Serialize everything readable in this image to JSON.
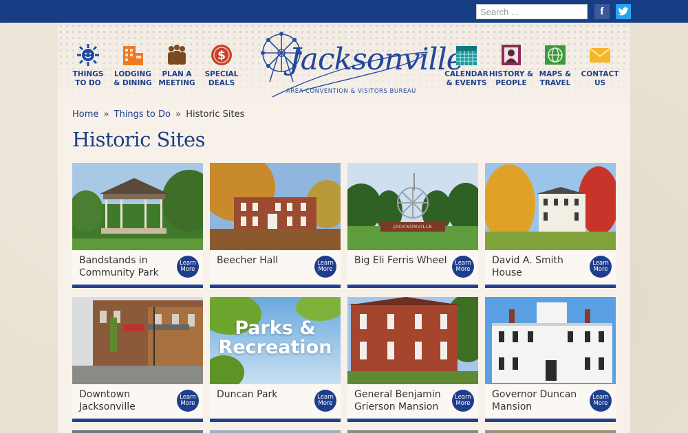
{
  "search": {
    "placeholder": "Search ..."
  },
  "social": {
    "facebook_label": "f",
    "twitter_label": "t"
  },
  "nav_left": [
    {
      "line1": "THINGS",
      "line2": "TO DO"
    },
    {
      "line1": "LODGING",
      "line2": "& DINING"
    },
    {
      "line1": "PLAN A",
      "line2": "MEETING"
    },
    {
      "line1": "SPECIAL",
      "line2": "DEALS"
    }
  ],
  "nav_right": [
    {
      "line1": "CALENDAR",
      "line2": "& EVENTS"
    },
    {
      "line1": "HISTORY &",
      "line2": "PEOPLE"
    },
    {
      "line1": "MAPS &",
      "line2": "TRAVEL"
    },
    {
      "line1": "CONTACT",
      "line2": "US"
    }
  ],
  "logo": {
    "word": "Jacksonville",
    "subtitle": "AREA CONVENTION & VISITORS BUREAU"
  },
  "breadcrumb": {
    "home": "Home",
    "sep1": "»",
    "things": "Things to Do",
    "sep2": "»",
    "current": "Historic Sites"
  },
  "page_title": "Historic Sites",
  "cards": [
    {
      "title_line1": "Bandstands in",
      "title_line2": "Community Park",
      "learn1": "Learn",
      "learn2": "More"
    },
    {
      "title_line1": "Beecher Hall",
      "title_line2": "",
      "learn1": "Learn",
      "learn2": "More"
    },
    {
      "title_line1": "Big Eli Ferris Wheel",
      "title_line2": "",
      "learn1": "Learn",
      "learn2": "More",
      "sign": "JACKSONVILLE"
    },
    {
      "title_line1": "David A. Smith",
      "title_line2": "House",
      "learn1": "Learn",
      "learn2": "More"
    },
    {
      "title_line1": "Downtown",
      "title_line2": "Jacksonville",
      "learn1": "Learn",
      "learn2": "More"
    },
    {
      "title_line1": "Duncan Park",
      "title_line2": "",
      "learn1": "Learn",
      "learn2": "More",
      "overlay1": "Parks &",
      "overlay2": "Recreation"
    },
    {
      "title_line1": "General Benjamin",
      "title_line2": "Grierson Mansion",
      "learn1": "Learn",
      "learn2": "More"
    },
    {
      "title_line1": "Governor Duncan",
      "title_line2": "Mansion",
      "learn1": "Learn",
      "learn2": "More"
    }
  ],
  "colors": {
    "topbar": "#173d85",
    "brand_blue": "#1e3f8a",
    "card_rule": "#23418f"
  }
}
